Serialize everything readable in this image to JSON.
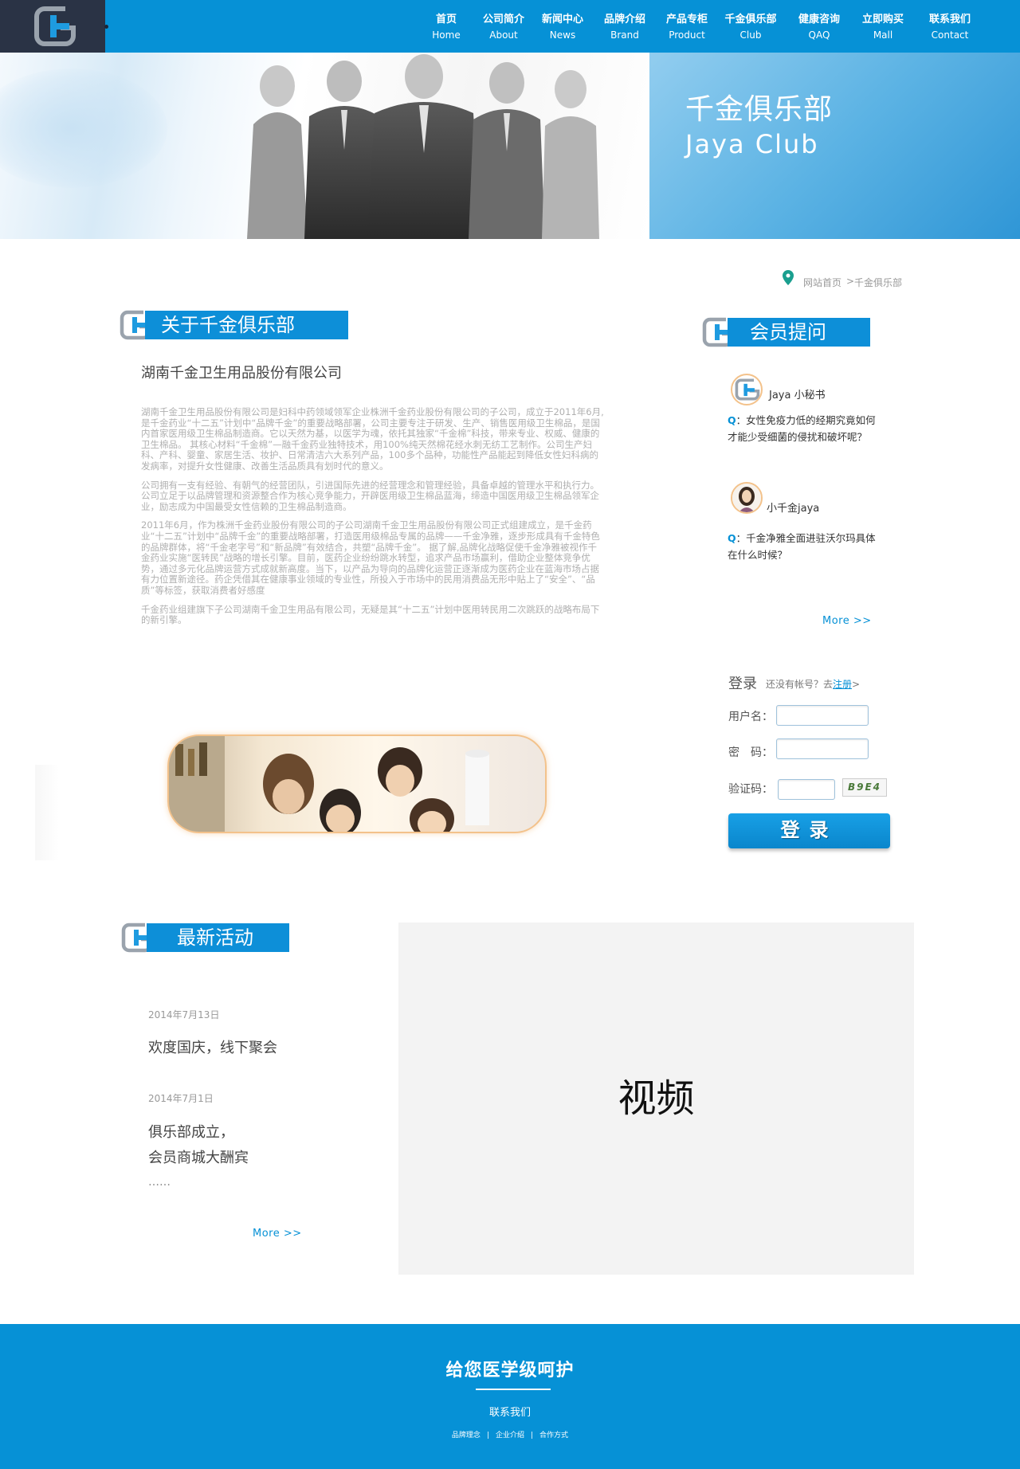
{
  "nav": {
    "items": [
      {
        "cn": "首页",
        "en": "Home"
      },
      {
        "cn": "公司简介",
        "en": "About"
      },
      {
        "cn": "新闻中心",
        "en": "News"
      },
      {
        "cn": "品牌介绍",
        "en": "Brand"
      },
      {
        "cn": "产品专柜",
        "en": "Product"
      },
      {
        "cn": "千金俱乐部",
        "en": "Club"
      },
      {
        "cn": "健康咨询",
        "en": "QAQ"
      },
      {
        "cn": "立即购买",
        "en": "Mall"
      },
      {
        "cn": "联系我们",
        "en": "Contact"
      }
    ]
  },
  "banner": {
    "title": "千金俱乐部",
    "subtitle": "Jaya  Club"
  },
  "breadcrumb": {
    "home": "网站首页",
    "separator": ">",
    "current": "千金俱乐部"
  },
  "about": {
    "heading": "关于千金俱乐部",
    "company": "湖南千金卫生用品股份有限公司",
    "paragraphs": [
      "湖南千金卫生用品股份有限公司是妇科中药领域领军企业株洲千金药业股份有限公司的子公司，成立于2011年6月,是千金药业“十二五”计划中“品牌千金”的重要战略部署，公司主要专注于研发、生产、销售医用级卫生棉品，是国内首家医用级卫生棉品制造商。它以天然为基，以医学为魂，依托其独家“千金棉”科技，带来专业、权威、健康的卫生棉品。 其核心材料“千金棉”—融千金药业独特技术，用100%纯天然棉花经水刺无纺工艺制作。公司生产妇科、产科、婴童、家居生活、妆护、日常清洁六大系列产品，100多个品种，功能性产品能起到降低女性妇科病的发病率，对提升女性健康、改善生活品质具有划时代的意义。",
      "公司拥有一支有经验、有朝气的经营团队，引进国际先进的经营理念和管理经验，具备卓越的管理水平和执行力。 公司立足于以品牌管理和资源整合作为核心竞争能力，开辟医用级卫生棉品蓝海，缔造中国医用级卫生棉品领军企业，励志成为中国最受女性信赖的卫生棉品制造商。",
      "2011年6月，作为株洲千金药业股份有限公司的子公司湖南千金卫生用品股份有限公司正式组建成立，是千金药业“十二五”计划中“品牌千金”的重要战略部署，打造医用级棉品专属的品牌——千金净雅，逐步形成具有千金特色的品牌群体，将“千金老字号”和“新品牌”有效结合，共塑“品牌千金”。 据了解,品牌化战略促使千金净雅被视作千金药业实施“医转民”战略的增长引擎。目前，医药企业纷纷跳水转型，追求产品市场赢利，借助企业整体竞争优势，通过多元化品牌运营方式成就新高度。当下，以产品为导向的品牌化运营正逐渐成为医药企业在蓝海市场占据有力位置新途径。药企凭借其在健康事业领域的专业性，所投入于市场中的民用消费品无形中贴上了“安全”、“品质”等标签，获取消费者好感度",
      "千金药业组建旗下子公司湖南千金卫生用品有限公司，无疑是其“十二五”计划中医用转民用二次跳跃的战略布局下的新引擎。"
    ]
  },
  "member_qa": {
    "heading": "会员提问",
    "items": [
      {
        "name": "Jaya 小秘书",
        "q_mark": "Q",
        "question": "：女性免疫力低的经期究竟如何才能少受细菌的侵扰和破坏呢？"
      },
      {
        "name": "小千金jaya",
        "q_mark": "Q",
        "question": "：千金净雅全面进驻沃尔玛具体在什么时候？"
      }
    ],
    "more": "More  >>"
  },
  "login": {
    "title": "登录",
    "hint_prefix": "还没有帐号？去",
    "register_link": "注册",
    "hint_suffix": ">",
    "username_label": "用户名：",
    "password_label": "密　码：",
    "captcha_label": "验证码：",
    "captcha_text": "B9E4",
    "submit": "登录"
  },
  "activities": {
    "heading": "最新活动",
    "items": [
      {
        "date": "2014年7月13日",
        "title": "欢度国庆，线下聚会"
      },
      {
        "date": "2014年7月1日",
        "title_line1": "俱乐部成立，",
        "title_line2": "会员商城大酬宾",
        "ellipsis": "……"
      }
    ],
    "more": "More  >>",
    "video_label": "视频"
  },
  "footer": {
    "title": "给您医学级呵护",
    "contact": "联系我们",
    "links": [
      "品牌理念",
      "企业介绍",
      "合作方式"
    ],
    "divider": "|"
  },
  "colors": {
    "brand_blue": "#0691d6",
    "logo_bg": "#2a3345",
    "gold_border": "#f3c28b"
  }
}
